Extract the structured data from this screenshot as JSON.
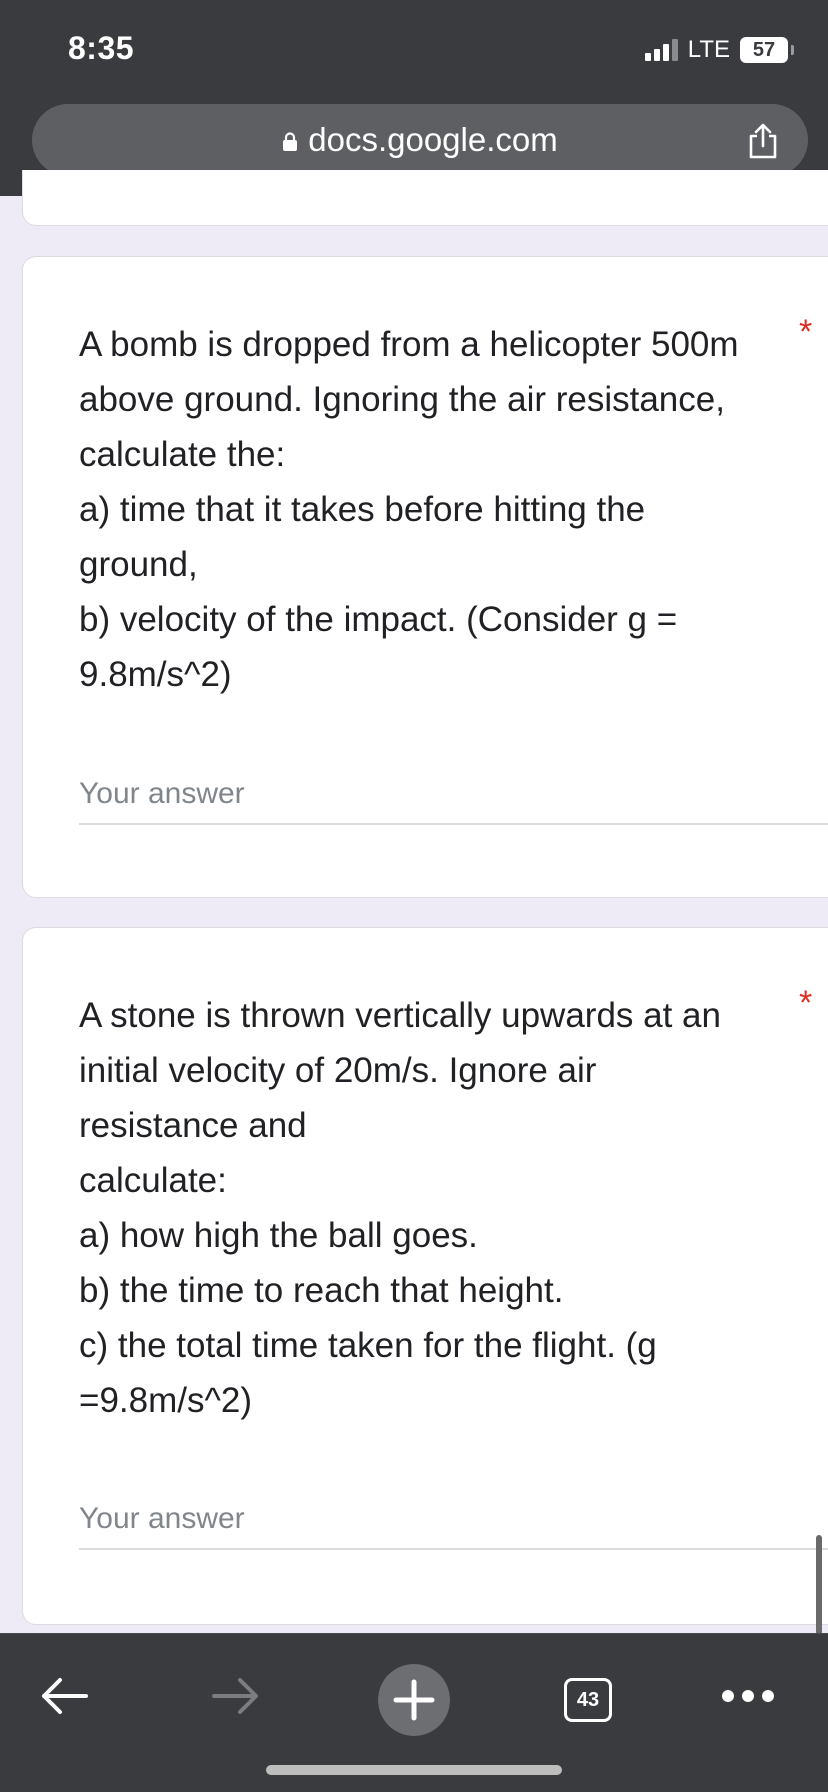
{
  "status_bar": {
    "time": "8:35",
    "network": "LTE",
    "battery": "57"
  },
  "browser": {
    "url": "docs.google.com",
    "tab_count": "43"
  },
  "questions": [
    {
      "lines": [
        "A bomb is dropped from a helicopter 500m",
        "above ground. Ignoring the air resistance,",
        "calculate the:",
        "a) time that it takes before hitting the",
        "ground,",
        "b) velocity of the impact. (Consider g =",
        "9.8m/s^2)"
      ],
      "required_mark": "*",
      "answer_placeholder": "Your answer",
      "answer_value": ""
    },
    {
      "lines": [
        "A stone is thrown vertically upwards at an",
        "initial velocity of 20m/s. Ignore air",
        "resistance and",
        "calculate:",
        "a) how high the ball goes.",
        "b) the time to reach that height.",
        "c) the total time taken for the flight. (g",
        "=9.8m/s^2)"
      ],
      "required_mark": "*",
      "answer_placeholder": "Your answer",
      "answer_value": ""
    }
  ],
  "colors": {
    "page_background": "#efebf6",
    "required": "#d93025",
    "chrome": "#3a3b3f"
  },
  "icons": {
    "lock": "lock-icon",
    "share": "share-icon",
    "back": "back-arrow-icon",
    "forward": "forward-arrow-icon",
    "new_tab": "plus-icon",
    "tabs": "tabs-icon",
    "more": "more-icon"
  }
}
